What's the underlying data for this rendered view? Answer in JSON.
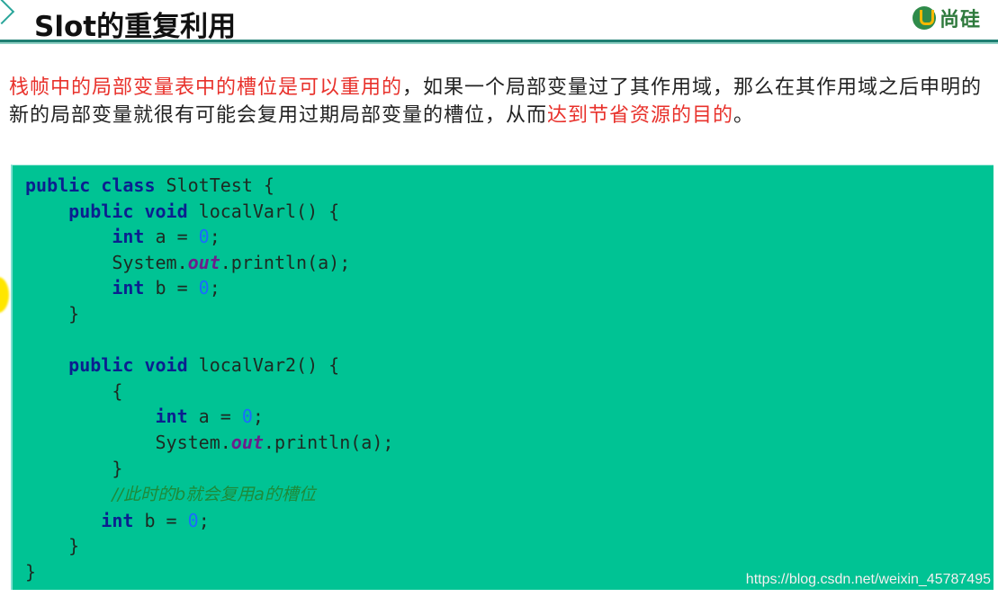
{
  "header": {
    "title": "Slot的重复利用",
    "logo_text": "尚硅",
    "logo_icon": "u-logo-icon",
    "chevron_icon": "chevron-right-icon"
  },
  "description": {
    "segments": [
      {
        "text": "栈帧中的局部变量表中的槽位是可以重用的",
        "highlight": true
      },
      {
        "text": "，如果一个局部变量过了其作用域，那么在其作用域之后申明的新的局部变量就很有可能会复用过期局部变量的槽位，从而",
        "highlight": false
      },
      {
        "text": "达到节省资源的目的",
        "highlight": true
      },
      {
        "text": "。",
        "highlight": false
      }
    ]
  },
  "code": {
    "lines": [
      [
        {
          "t": "public class ",
          "c": "kw"
        },
        {
          "t": "SlotTest {",
          "c": ""
        }
      ],
      [
        {
          "t": "    ",
          "c": ""
        },
        {
          "t": "public void ",
          "c": "kw"
        },
        {
          "t": "localVarl() {",
          "c": ""
        }
      ],
      [
        {
          "t": "        ",
          "c": ""
        },
        {
          "t": "int ",
          "c": "kw"
        },
        {
          "t": "a = ",
          "c": ""
        },
        {
          "t": "0",
          "c": "num"
        },
        {
          "t": ";",
          "c": ""
        }
      ],
      [
        {
          "t": "        System.",
          "c": ""
        },
        {
          "t": "out",
          "c": "field"
        },
        {
          "t": ".println(a);",
          "c": ""
        }
      ],
      [
        {
          "t": "        ",
          "c": ""
        },
        {
          "t": "int ",
          "c": "kw"
        },
        {
          "t": "b = ",
          "c": ""
        },
        {
          "t": "0",
          "c": "num"
        },
        {
          "t": ";",
          "c": ""
        }
      ],
      [
        {
          "t": "    }",
          "c": ""
        }
      ],
      [
        {
          "t": "",
          "c": ""
        }
      ],
      [
        {
          "t": "    ",
          "c": ""
        },
        {
          "t": "public void ",
          "c": "kw"
        },
        {
          "t": "localVar2() {",
          "c": ""
        }
      ],
      [
        {
          "t": "        {",
          "c": ""
        }
      ],
      [
        {
          "t": "            ",
          "c": ""
        },
        {
          "t": "int ",
          "c": "kw"
        },
        {
          "t": "a = ",
          "c": ""
        },
        {
          "t": "0",
          "c": "num"
        },
        {
          "t": ";",
          "c": ""
        }
      ],
      [
        {
          "t": "            System.",
          "c": ""
        },
        {
          "t": "out",
          "c": "field"
        },
        {
          "t": ".println(a);",
          "c": ""
        }
      ],
      [
        {
          "t": "        }",
          "c": ""
        }
      ],
      [
        {
          "t": "        ",
          "c": ""
        },
        {
          "t": "//此时的b就会复用a的槽位",
          "c": "comment"
        }
      ],
      [
        {
          "t": "       ",
          "c": ""
        },
        {
          "t": "int ",
          "c": "kw"
        },
        {
          "t": "b = ",
          "c": ""
        },
        {
          "t": "0",
          "c": "num"
        },
        {
          "t": ";",
          "c": ""
        }
      ],
      [
        {
          "t": "    }",
          "c": ""
        }
      ],
      [
        {
          "t": "}",
          "c": ""
        }
      ]
    ]
  },
  "watermark": "https://blog.csdn.net/weixin_45787495",
  "colors": {
    "accent": "#1f7f72",
    "code_bg": "#00c394",
    "highlight_red": "#e8312b",
    "keyword": "#0b1f8f",
    "number": "#1a6bff",
    "comment": "#1e8a3a"
  }
}
